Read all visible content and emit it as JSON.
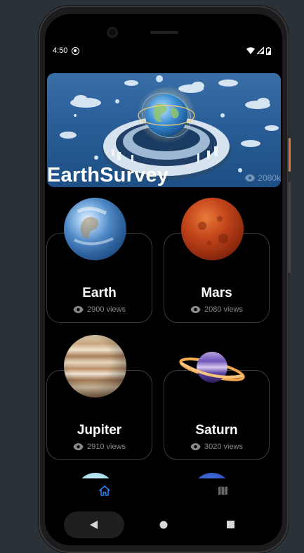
{
  "status_bar": {
    "time": "4:50"
  },
  "banner": {
    "title": "EarthSurvey",
    "views": "2080k"
  },
  "cards": [
    {
      "title": "Earth",
      "views": "2900 views"
    },
    {
      "title": "Mars",
      "views": "2080 views"
    },
    {
      "title": "Jupiter",
      "views": "2910 views"
    },
    {
      "title": "Saturn",
      "views": "3020 views"
    }
  ],
  "bottom_nav": {
    "items": [
      "home-icon",
      "map-icon"
    ],
    "active_color": "#2f80ed"
  },
  "system_nav": {
    "items": [
      "back",
      "home",
      "recents"
    ]
  }
}
